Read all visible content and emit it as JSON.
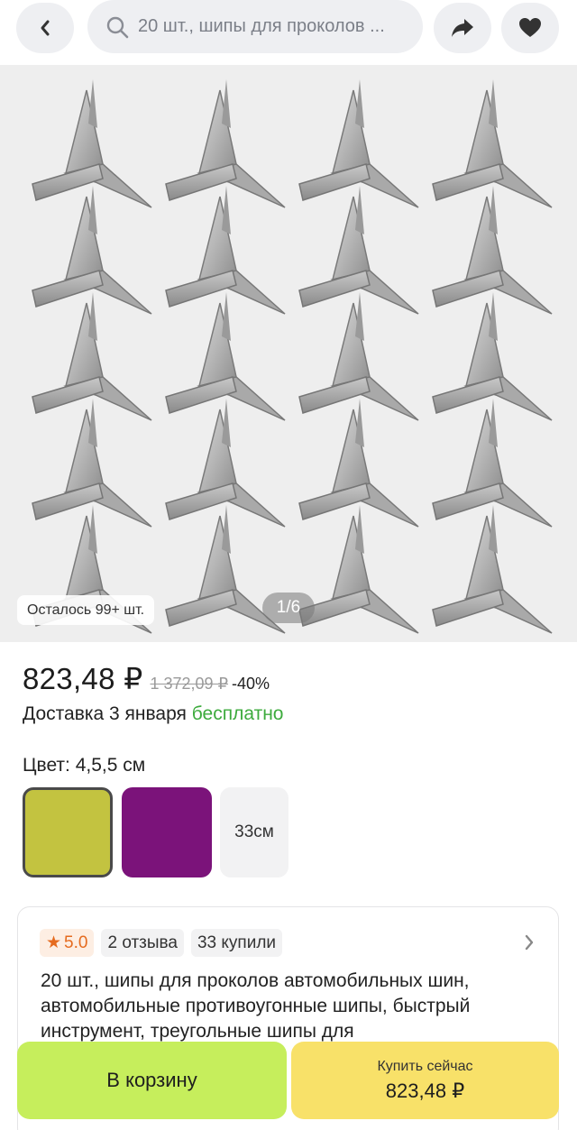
{
  "header": {
    "search_text": "20 шт., шипы для проколов ...",
    "icons": [
      "back-icon",
      "search-icon",
      "share-icon",
      "heart-icon"
    ]
  },
  "gallery": {
    "stock_badge": "Осталось 99+ шт.",
    "page_counter": "1/6"
  },
  "price": {
    "current": "823,48 ₽",
    "old": "1 372,09 ₽",
    "discount": "-40%"
  },
  "delivery": {
    "label": "Доставка 3 января",
    "free": "бесплатно"
  },
  "color": {
    "label": "Цвет: 4,5,5 см",
    "options": [
      {
        "color": "#c3c340",
        "selected": true
      },
      {
        "color": "#7b137a",
        "selected": false
      },
      {
        "label": "33см",
        "selected": false
      }
    ]
  },
  "card": {
    "rating": "5.0",
    "reviews": "2 отзыва",
    "bought": "33 купили",
    "title": "20 шт., шипы для проколов автомобильных шин, автомобильные противоугонные шипы, быстрый инструмент, треугольные шипы для"
  },
  "actions": {
    "cart": "В корзину",
    "buy_label": "Купить сейчас",
    "buy_price": "823,48 ₽"
  },
  "colors": {
    "accent_green": "#c6ee5c",
    "accent_yellow": "#f8e169",
    "free_green": "#3dab3d",
    "rating_orange": "#e56b1f"
  }
}
